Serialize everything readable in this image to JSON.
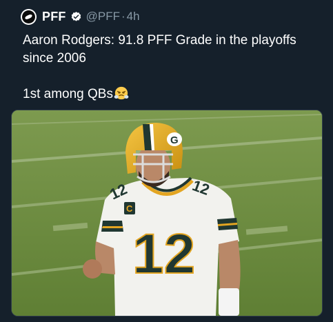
{
  "tweet": {
    "author_name": "PFF",
    "handle": "@PFF",
    "separator": "·",
    "time": "4h",
    "text_line1": "Aaron Rodgers: 91.8 PFF Grade in the playoffs",
    "text_line2": "since 2006",
    "text_line3": "1st among QBs",
    "emoji_name": "face-with-steam-emoji",
    "jersey_number": "12",
    "helmet_letter": "G",
    "captain_letter": "C"
  },
  "colors": {
    "background": "#15202b",
    "secondary_text": "#8899a6",
    "verified_badge": "#ffffff",
    "jersey_green": "#203731",
    "helmet_gold": "#e3a521",
    "field_green": "#6f8f41"
  }
}
